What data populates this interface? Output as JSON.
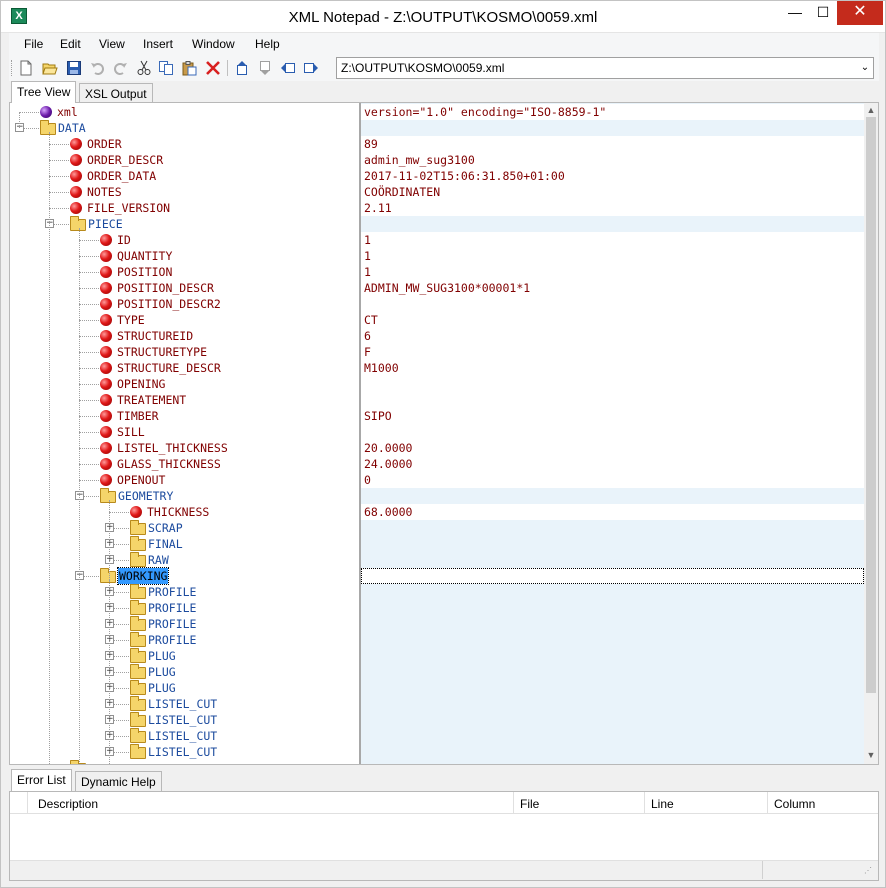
{
  "window": {
    "title": "XML Notepad - Z:\\OUTPUT\\KOSMO\\0059.xml",
    "minimize_glyph": "—",
    "maximize_glyph": "☐",
    "close_glyph": "✕"
  },
  "menu": [
    "File",
    "Edit",
    "View",
    "Insert",
    "Window",
    "Help"
  ],
  "toolbar": {
    "buttons": [
      "new-icon",
      "open-icon",
      "save-icon",
      "undo-icon",
      "redo-icon",
      "cut-icon",
      "copy-icon",
      "paste-icon",
      "delete-icon",
      "nudge-up-icon",
      "nudge-down-icon",
      "nudge-left-icon",
      "nudge-right-icon"
    ],
    "path_value": "Z:\\OUTPUT\\KOSMO\\0059.xml"
  },
  "tabs_top": [
    "Tree View",
    "XSL Output"
  ],
  "tree": [
    {
      "label": "xml",
      "kind": "pi",
      "value": "version=\"1.0\" encoding=\"ISO-8859-1\""
    },
    {
      "label": "DATA",
      "kind": "folder",
      "value": "",
      "expanded": true
    },
    {
      "label": "ORDER",
      "kind": "attr",
      "value": "89"
    },
    {
      "label": "ORDER_DESCR",
      "kind": "attr",
      "value": "admin_mw_sug3100"
    },
    {
      "label": "ORDER_DATA",
      "kind": "attr",
      "value": "2017-11-02T15:06:31.850+01:00"
    },
    {
      "label": "NOTES",
      "kind": "attr",
      "value": "COÖRDINATEN"
    },
    {
      "label": "FILE_VERSION",
      "kind": "attr",
      "value": "2.11"
    },
    {
      "label": "PIECE",
      "kind": "folder",
      "value": "",
      "expanded": true
    },
    {
      "label": "ID",
      "kind": "attr",
      "value": "1"
    },
    {
      "label": "QUANTITY",
      "kind": "attr",
      "value": "1"
    },
    {
      "label": "POSITION",
      "kind": "attr",
      "value": "1"
    },
    {
      "label": "POSITION_DESCR",
      "kind": "attr",
      "value": "ADMIN_MW_SUG3100*00001*1"
    },
    {
      "label": "POSITION_DESCR2",
      "kind": "attr",
      "value": ""
    },
    {
      "label": "TYPE",
      "kind": "attr",
      "value": "CT"
    },
    {
      "label": "STRUCTUREID",
      "kind": "attr",
      "value": "6"
    },
    {
      "label": "STRUCTURETYPE",
      "kind": "attr",
      "value": "F"
    },
    {
      "label": "STRUCTURE_DESCR",
      "kind": "attr",
      "value": "M1000"
    },
    {
      "label": "OPENING",
      "kind": "attr",
      "value": ""
    },
    {
      "label": "TREATEMENT",
      "kind": "attr",
      "value": ""
    },
    {
      "label": "TIMBER",
      "kind": "attr",
      "value": "SIPO"
    },
    {
      "label": "SILL",
      "kind": "attr",
      "value": ""
    },
    {
      "label": "LISTEL_THICKNESS",
      "kind": "attr",
      "value": "20.0000"
    },
    {
      "label": "GLASS_THICKNESS",
      "kind": "attr",
      "value": "24.0000"
    },
    {
      "label": "OPENOUT",
      "kind": "attr",
      "value": "0"
    },
    {
      "label": "GEOMETRY",
      "kind": "folder",
      "value": "",
      "expanded": true
    },
    {
      "label": "THICKNESS",
      "kind": "attr",
      "value": "68.0000"
    },
    {
      "label": "SCRAP",
      "kind": "folder",
      "value": "",
      "expanded": false
    },
    {
      "label": "FINAL",
      "kind": "folder",
      "value": "",
      "expanded": false
    },
    {
      "label": "RAW",
      "kind": "folder",
      "value": "",
      "expanded": false
    },
    {
      "label": "WORKING",
      "kind": "folder",
      "value": "",
      "expanded": true,
      "selected": true
    },
    {
      "label": "PROFILE",
      "kind": "folder",
      "value": "",
      "expanded": false
    },
    {
      "label": "PROFILE",
      "kind": "folder",
      "value": "",
      "expanded": false
    },
    {
      "label": "PROFILE",
      "kind": "folder",
      "value": "",
      "expanded": false
    },
    {
      "label": "PROFILE",
      "kind": "folder",
      "value": "",
      "expanded": false
    },
    {
      "label": "PLUG",
      "kind": "folder",
      "value": "",
      "expanded": false
    },
    {
      "label": "PLUG",
      "kind": "folder",
      "value": "",
      "expanded": false
    },
    {
      "label": "PLUG",
      "kind": "folder",
      "value": "",
      "expanded": false
    },
    {
      "label": "LISTEL_CUT",
      "kind": "folder",
      "value": "",
      "expanded": false
    },
    {
      "label": "LISTEL_CUT",
      "kind": "folder",
      "value": "",
      "expanded": false
    },
    {
      "label": "LISTEL_CUT",
      "kind": "folder",
      "value": "",
      "expanded": false
    },
    {
      "label": "LISTEL_CUT",
      "kind": "folder",
      "value": "",
      "expanded": false
    }
  ],
  "tabs_bottom": [
    "Error List",
    "Dynamic Help"
  ],
  "error_columns": [
    "Description",
    "File",
    "Line",
    "Column"
  ],
  "scroll": {
    "up_glyph": "▲",
    "down_glyph": "▼"
  }
}
